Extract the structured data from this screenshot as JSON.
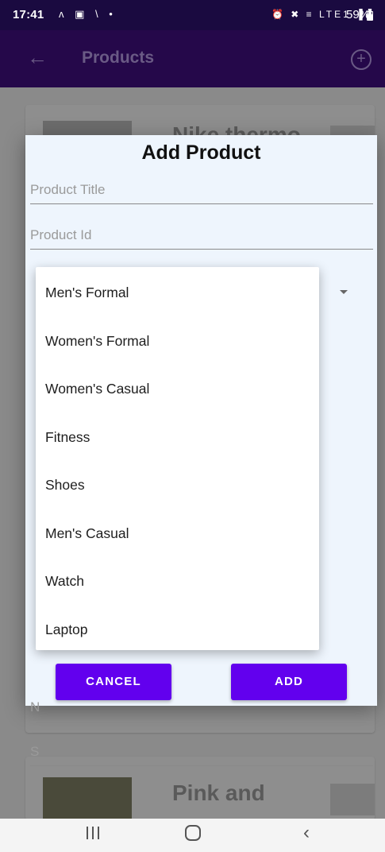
{
  "status_bar": {
    "time": "17:41",
    "left_icons": "ʌ ▣ \\ •",
    "right_icons": "⏰ ✖ ≡ LTE1 ▐▐",
    "battery": "59%"
  },
  "app_bar": {
    "back_icon": "←",
    "title": "Products",
    "add_icon": "+"
  },
  "background_list": {
    "items": [
      {
        "title": "Nike thermo"
      },
      {
        "title": "Pink and"
      }
    ]
  },
  "dialog": {
    "title": "Add Product",
    "product_title_placeholder": "Product Title",
    "product_id_placeholder": "Product Id",
    "name_placeholder": "N",
    "s_placeholder": "S",
    "cancel_label": "CANCEL",
    "add_label": "ADD"
  },
  "category_menu": {
    "items": [
      "Men's Formal",
      "Women's Formal",
      "Women's Casual",
      "Fitness",
      "Shoes",
      "Men's Casual",
      "Watch",
      "Laptop"
    ]
  },
  "nav_bar": {
    "back_icon": "‹"
  },
  "colors": {
    "primary": "#6200ee",
    "app_bar": "#25084a",
    "dialog_bg": "#eef5fd"
  }
}
